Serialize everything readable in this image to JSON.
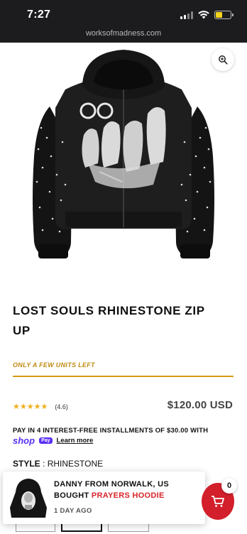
{
  "status_bar": {
    "time": "7:27"
  },
  "browser": {
    "url": "worksofmadness.com"
  },
  "product": {
    "title": "LOST SOULS RHINESTONE ZIP UP",
    "stock_notice": "ONLY A FEW UNITS LEFT",
    "rating_text": "(4.6)",
    "rating_value": 4.6,
    "rating_max": 5,
    "price": "$120.00 USD",
    "installments_text": "PAY IN 4 INTEREST-FREE INSTALLMENTS OF $30.00 WITH",
    "shop_logo": "shop",
    "shop_pay_badge": "Pay",
    "learn_more": "Learn more",
    "style_label": "STYLE",
    "style_separator": " : ",
    "style_value": "RHINESTONE"
  },
  "popup": {
    "name": "DANNY FROM NORWALK, US",
    "bought_prefix": "BOUGHT ",
    "product": "PRAYERS HOODIE",
    "time": "1 DAY AGO"
  },
  "cart": {
    "count": "0"
  },
  "colors": {
    "accent_gold": "#d89a14",
    "cart_red": "#d21f2b",
    "shop_purple": "#5a31f4",
    "popup_product": "#d8232a"
  },
  "icons": {
    "zoom": "zoom-icon",
    "cart": "cart-icon",
    "wifi": "wifi-icon",
    "battery": "battery-icon",
    "signal": "signal-icon"
  }
}
